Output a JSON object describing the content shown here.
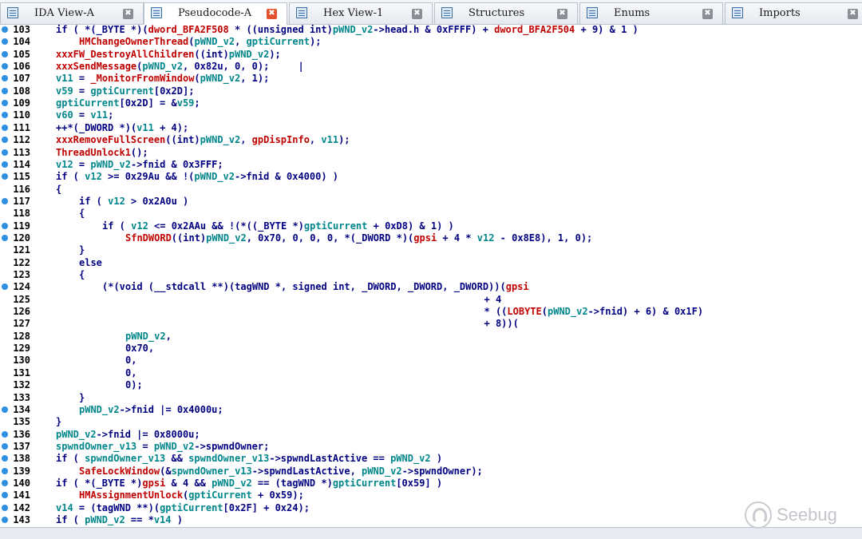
{
  "tabs": [
    {
      "label": "IDA View-A",
      "icon": "ida-view-icon",
      "active": false
    },
    {
      "label": "Pseudocode-A",
      "icon": "pseudocode-icon",
      "active": true
    },
    {
      "label": "Hex View-1",
      "icon": "hex-view-icon",
      "active": false
    },
    {
      "label": "Structures",
      "icon": "structures-icon",
      "active": false
    },
    {
      "label": "Enums",
      "icon": "enums-icon",
      "active": false
    },
    {
      "label": "Imports",
      "icon": "imports-icon",
      "active": false
    }
  ],
  "colors": {
    "keyword": "#000080",
    "variable": "#00868b",
    "function": "#c00000",
    "breakpoint": "#2f8fe0",
    "active_close": "#e5522f"
  },
  "lines": [
    {
      "n": "103",
      "bp": true,
      "indent": 0,
      "tokens": [
        [
          "k",
          "if ( *("
        ],
        [
          "t",
          "_BYTE"
        ],
        [
          "k",
          " *)("
        ],
        [
          "f",
          "dword_BFA2F508"
        ],
        [
          "k",
          " * ((unsigned int)"
        ],
        [
          "v",
          "pWND_v2"
        ],
        [
          "k",
          "->head.h & 0xFFFF) + "
        ],
        [
          "f",
          "dword_BFA2F504"
        ],
        [
          "k",
          " + 9) & 1 )"
        ]
      ]
    },
    {
      "n": "104",
      "bp": true,
      "indent": 1,
      "tokens": [
        [
          "f",
          "HMChangeOwnerThread"
        ],
        [
          "k",
          "("
        ],
        [
          "v",
          "pWND_v2"
        ],
        [
          "k",
          ", "
        ],
        [
          "v",
          "gptiCurrent"
        ],
        [
          "k",
          ");"
        ]
      ]
    },
    {
      "n": "105",
      "bp": true,
      "indent": 0,
      "tokens": [
        [
          "f",
          "xxxFW_DestroyAllChildren"
        ],
        [
          "k",
          "((int)"
        ],
        [
          "v",
          "pWND_v2"
        ],
        [
          "k",
          ");"
        ]
      ]
    },
    {
      "n": "106",
      "bp": true,
      "indent": 0,
      "tokens": [
        [
          "f",
          "xxxSendMessage"
        ],
        [
          "k",
          "("
        ],
        [
          "v",
          "pWND_v2"
        ],
        [
          "k",
          ", 0x82u, 0, 0);     |"
        ]
      ]
    },
    {
      "n": "107",
      "bp": true,
      "indent": 0,
      "tokens": [
        [
          "v",
          "v11"
        ],
        [
          "k",
          " = "
        ],
        [
          "f",
          "_MonitorFromWindow"
        ],
        [
          "k",
          "("
        ],
        [
          "v",
          "pWND_v2"
        ],
        [
          "k",
          ", 1);"
        ]
      ]
    },
    {
      "n": "108",
      "bp": true,
      "indent": 0,
      "tokens": [
        [
          "v",
          "v59"
        ],
        [
          "k",
          " = "
        ],
        [
          "v",
          "gptiCurrent"
        ],
        [
          "k",
          "[0x2D];"
        ]
      ]
    },
    {
      "n": "109",
      "bp": true,
      "indent": 0,
      "tokens": [
        [
          "v",
          "gptiCurrent"
        ],
        [
          "k",
          "[0x2D] = &"
        ],
        [
          "v",
          "v59"
        ],
        [
          "k",
          ";"
        ]
      ]
    },
    {
      "n": "110",
      "bp": true,
      "indent": 0,
      "tokens": [
        [
          "v",
          "v60"
        ],
        [
          "k",
          " = "
        ],
        [
          "v",
          "v11"
        ],
        [
          "k",
          ";"
        ]
      ]
    },
    {
      "n": "111",
      "bp": true,
      "indent": 0,
      "tokens": [
        [
          "k",
          "++*("
        ],
        [
          "t",
          "_DWORD"
        ],
        [
          "k",
          " *)("
        ],
        [
          "v",
          "v11"
        ],
        [
          "k",
          " + 4);"
        ]
      ]
    },
    {
      "n": "112",
      "bp": true,
      "indent": 0,
      "tokens": [
        [
          "f",
          "xxxRemoveFullScreen"
        ],
        [
          "k",
          "((int)"
        ],
        [
          "v",
          "pWND_v2"
        ],
        [
          "k",
          ", "
        ],
        [
          "f",
          "gpDispInfo"
        ],
        [
          "k",
          ", "
        ],
        [
          "v",
          "v11"
        ],
        [
          "k",
          ");"
        ]
      ]
    },
    {
      "n": "113",
      "bp": true,
      "indent": 0,
      "tokens": [
        [
          "f",
          "ThreadUnlock1"
        ],
        [
          "k",
          "();"
        ]
      ]
    },
    {
      "n": "114",
      "bp": true,
      "indent": 0,
      "tokens": [
        [
          "v",
          "v12"
        ],
        [
          "k",
          " = "
        ],
        [
          "v",
          "pWND_v2"
        ],
        [
          "k",
          "->fnid & 0x3FFF;"
        ]
      ]
    },
    {
      "n": "115",
      "bp": true,
      "indent": 0,
      "tokens": [
        [
          "k",
          "if ( "
        ],
        [
          "v",
          "v12"
        ],
        [
          "k",
          " >= 0x29Au && !("
        ],
        [
          "v",
          "pWND_v2"
        ],
        [
          "k",
          "->fnid & 0x4000) )"
        ]
      ]
    },
    {
      "n": "116",
      "bp": false,
      "indent": 0,
      "tokens": [
        [
          "k",
          "{"
        ]
      ]
    },
    {
      "n": "117",
      "bp": true,
      "indent": 1,
      "tokens": [
        [
          "k",
          "if ( "
        ],
        [
          "v",
          "v12"
        ],
        [
          "k",
          " > 0x2A0u )"
        ]
      ]
    },
    {
      "n": "118",
      "bp": false,
      "indent": 1,
      "tokens": [
        [
          "k",
          "{"
        ]
      ]
    },
    {
      "n": "119",
      "bp": true,
      "indent": 2,
      "tokens": [
        [
          "k",
          "if ( "
        ],
        [
          "v",
          "v12"
        ],
        [
          "k",
          " <= 0x2AAu && !(*(("
        ],
        [
          "t",
          "_BYTE"
        ],
        [
          "k",
          " *)"
        ],
        [
          "v",
          "gptiCurrent"
        ],
        [
          "k",
          " + 0xD8) & 1) )"
        ]
      ]
    },
    {
      "n": "120",
      "bp": true,
      "indent": 3,
      "tokens": [
        [
          "f",
          "SfnDWORD"
        ],
        [
          "k",
          "((int)"
        ],
        [
          "v",
          "pWND_v2"
        ],
        [
          "k",
          ", 0x70, 0, 0, 0, *("
        ],
        [
          "t",
          "_DWORD"
        ],
        [
          "k",
          " *)("
        ],
        [
          "f",
          "gpsi"
        ],
        [
          "k",
          " + 4 * "
        ],
        [
          "v",
          "v12"
        ],
        [
          "k",
          " - 0x8E8), 1, 0);"
        ]
      ]
    },
    {
      "n": "121",
      "bp": false,
      "indent": 1,
      "tokens": [
        [
          "k",
          "}"
        ]
      ]
    },
    {
      "n": "122",
      "bp": false,
      "indent": 1,
      "tokens": [
        [
          "k",
          "else"
        ]
      ]
    },
    {
      "n": "123",
      "bp": false,
      "indent": 1,
      "tokens": [
        [
          "k",
          "{"
        ]
      ]
    },
    {
      "n": "124",
      "bp": true,
      "indent": 2,
      "tokens": [
        [
          "k",
          "(*(void (__stdcall **)(tagWND *, signed int, _DWORD, _DWORD, _DWORD))("
        ],
        [
          "f",
          "gpsi"
        ]
      ]
    },
    {
      "n": "125",
      "bp": false,
      "indent": 0,
      "pad": 74,
      "tokens": [
        [
          "k",
          "+ 4"
        ]
      ]
    },
    {
      "n": "126",
      "bp": false,
      "indent": 0,
      "pad": 74,
      "tokens": [
        [
          "k",
          "* (("
        ],
        [
          "f",
          "LOBYTE"
        ],
        [
          "k",
          "("
        ],
        [
          "v",
          "pWND_v2"
        ],
        [
          "k",
          "->fnid) + 6) & 0x1F)"
        ]
      ]
    },
    {
      "n": "127",
      "bp": false,
      "indent": 0,
      "pad": 74,
      "tokens": [
        [
          "k",
          "+ 8))("
        ]
      ]
    },
    {
      "n": "128",
      "bp": false,
      "indent": 3,
      "tokens": [
        [
          "v",
          "pWND_v2"
        ],
        [
          "k",
          ","
        ]
      ]
    },
    {
      "n": "129",
      "bp": false,
      "indent": 3,
      "tokens": [
        [
          "k",
          "0x70,"
        ]
      ]
    },
    {
      "n": "130",
      "bp": false,
      "indent": 3,
      "tokens": [
        [
          "k",
          "0,"
        ]
      ]
    },
    {
      "n": "131",
      "bp": false,
      "indent": 3,
      "tokens": [
        [
          "k",
          "0,"
        ]
      ]
    },
    {
      "n": "132",
      "bp": false,
      "indent": 3,
      "tokens": [
        [
          "k",
          "0);"
        ]
      ]
    },
    {
      "n": "133",
      "bp": false,
      "indent": 1,
      "tokens": [
        [
          "k",
          "}"
        ]
      ]
    },
    {
      "n": "134",
      "bp": true,
      "indent": 1,
      "tokens": [
        [
          "v",
          "pWND_v2"
        ],
        [
          "k",
          "->fnid |= 0x4000u;"
        ]
      ]
    },
    {
      "n": "135",
      "bp": false,
      "indent": 0,
      "tokens": [
        [
          "k",
          "}"
        ]
      ]
    },
    {
      "n": "136",
      "bp": true,
      "indent": 0,
      "tokens": [
        [
          "v",
          "pWND_v2"
        ],
        [
          "k",
          "->fnid |= 0x8000u;"
        ]
      ]
    },
    {
      "n": "137",
      "bp": true,
      "indent": 0,
      "tokens": [
        [
          "v",
          "spwndOwner_v13"
        ],
        [
          "k",
          " = "
        ],
        [
          "v",
          "pWND_v2"
        ],
        [
          "k",
          "->spwndOwner;"
        ]
      ]
    },
    {
      "n": "138",
      "bp": true,
      "indent": 0,
      "tokens": [
        [
          "k",
          "if ( "
        ],
        [
          "v",
          "spwndOwner_v13"
        ],
        [
          "k",
          " && "
        ],
        [
          "v",
          "spwndOwner_v13"
        ],
        [
          "k",
          "->spwndLastActive == "
        ],
        [
          "v",
          "pWND_v2"
        ],
        [
          "k",
          " )"
        ]
      ]
    },
    {
      "n": "139",
      "bp": true,
      "indent": 1,
      "tokens": [
        [
          "f",
          "SafeLockWindow"
        ],
        [
          "k",
          "(&"
        ],
        [
          "v",
          "spwndOwner_v13"
        ],
        [
          "k",
          "->spwndLastActive, "
        ],
        [
          "v",
          "pWND_v2"
        ],
        [
          "k",
          "->spwndOwner);"
        ]
      ]
    },
    {
      "n": "140",
      "bp": true,
      "indent": 0,
      "tokens": [
        [
          "k",
          "if ( *("
        ],
        [
          "t",
          "_BYTE"
        ],
        [
          "k",
          " *)"
        ],
        [
          "f",
          "gpsi"
        ],
        [
          "k",
          " & 4 && "
        ],
        [
          "v",
          "pWND_v2"
        ],
        [
          "k",
          " == (tagWND *)"
        ],
        [
          "v",
          "gptiCurrent"
        ],
        [
          "k",
          "[0x59] )"
        ]
      ]
    },
    {
      "n": "141",
      "bp": true,
      "indent": 1,
      "tokens": [
        [
          "f",
          "HMAssignmentUnlock"
        ],
        [
          "k",
          "("
        ],
        [
          "v",
          "gptiCurrent"
        ],
        [
          "k",
          " + 0x59);"
        ]
      ]
    },
    {
      "n": "142",
      "bp": true,
      "indent": 0,
      "tokens": [
        [
          "v",
          "v14"
        ],
        [
          "k",
          " = (tagWND **)("
        ],
        [
          "v",
          "gptiCurrent"
        ],
        [
          "k",
          "[0x2F] + 0x24);"
        ]
      ]
    },
    {
      "n": "143",
      "bp": true,
      "indent": 0,
      "tokens": [
        [
          "k",
          "if ( "
        ],
        [
          "v",
          "pWND_v2"
        ],
        [
          "k",
          " == *"
        ],
        [
          "v",
          "v14"
        ],
        [
          "k",
          " )"
        ]
      ]
    }
  ],
  "watermark": {
    "text": "Seebug",
    "icon": "seebug-logo-icon"
  }
}
